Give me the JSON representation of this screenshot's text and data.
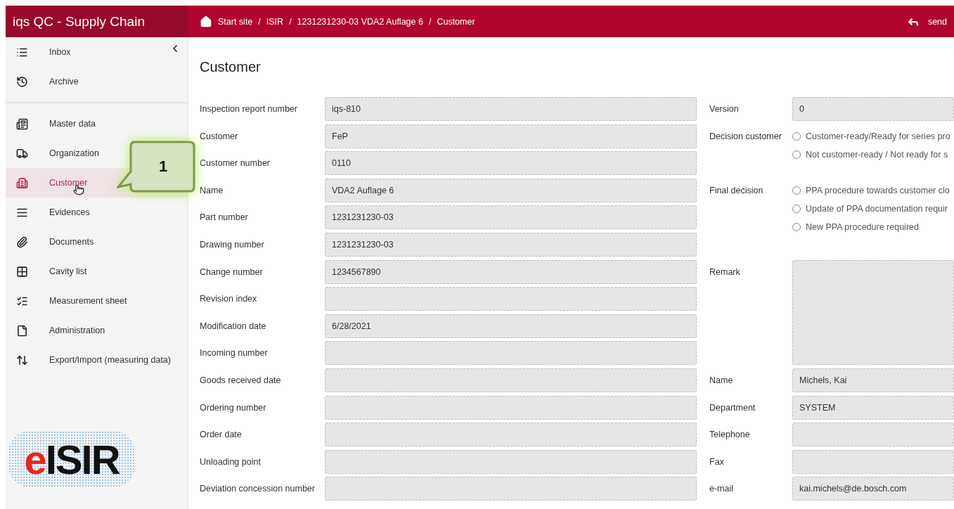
{
  "app": {
    "title": "iqs QC - Supply Chain"
  },
  "breadcrumbs": {
    "separator": "/",
    "items": [
      "Start site",
      "ISIR",
      "1231231230-03 VDA2 Auflage 6",
      "Customer"
    ]
  },
  "header_action": {
    "label": "send"
  },
  "sidebar": {
    "groups": [
      [
        {
          "label": "Inbox",
          "selected": false
        },
        {
          "label": "Archive",
          "selected": false
        }
      ],
      [
        {
          "label": "Master data",
          "selected": false
        },
        {
          "label": "Organization",
          "selected": false
        },
        {
          "label": "Customer",
          "selected": true
        },
        {
          "label": "Evidences",
          "selected": false
        },
        {
          "label": "Documents",
          "selected": false
        },
        {
          "label": "Cavity list",
          "selected": false
        },
        {
          "label": "Measurement sheet",
          "selected": false
        },
        {
          "label": "Administration",
          "selected": false
        },
        {
          "label": "Export/Import (measuring data)",
          "selected": false
        }
      ]
    ]
  },
  "logo": {
    "accent": "e",
    "main": "ISIR"
  },
  "callout": {
    "text": "1"
  },
  "page": {
    "title": "Customer"
  },
  "form_left": [
    {
      "label": "Inspection report number",
      "value": "iqs-810"
    },
    {
      "label": "Customer",
      "value": "FeP"
    },
    {
      "label": "Customer number",
      "value": "0110"
    },
    {
      "label": "Name",
      "value": "VDA2 Auflage 6"
    },
    {
      "label": "Part number",
      "value": "1231231230-03"
    },
    {
      "label": "Drawing number",
      "value": "1231231230-03"
    },
    {
      "label": "Change number",
      "value": "1234567890"
    },
    {
      "label": "Revision index"
    },
    {
      "label": "Modification date",
      "value": "6/28/2021"
    },
    {
      "label": "Incoming number"
    },
    {
      "label": "Goods received date"
    },
    {
      "label": "Ordering number"
    },
    {
      "label": "Order date"
    },
    {
      "label": "Unloading point"
    },
    {
      "label": "Deviation concession number"
    }
  ],
  "form_right": [
    {
      "kind": "field",
      "label": "Version",
      "value": "0"
    },
    {
      "kind": "radio",
      "label": "Decision customer",
      "options": [
        {
          "label": "Customer-ready/Ready for series pro",
          "selected": false
        },
        {
          "label": "Not customer-ready / Not ready for s",
          "selected": false
        }
      ]
    },
    {
      "kind": "radio",
      "label": "Final decision",
      "options": [
        {
          "label": "PPA procedure towards customer clo",
          "selected": false
        },
        {
          "label": "Update of PPA documentation requir",
          "selected": false
        },
        {
          "label": "New PPA procedure required",
          "selected": false
        }
      ]
    },
    {
      "kind": "textarea",
      "label": "Remark"
    },
    {
      "kind": "field",
      "label": "Name",
      "value": "Michels, Kai"
    },
    {
      "kind": "field",
      "label": "Department",
      "value": "SYSTEM"
    },
    {
      "kind": "field",
      "label": "Telephone"
    },
    {
      "kind": "field",
      "label": "Fax"
    },
    {
      "kind": "field",
      "label": "e-mail",
      "value": "kai.michels@de.bosch.com"
    }
  ]
}
